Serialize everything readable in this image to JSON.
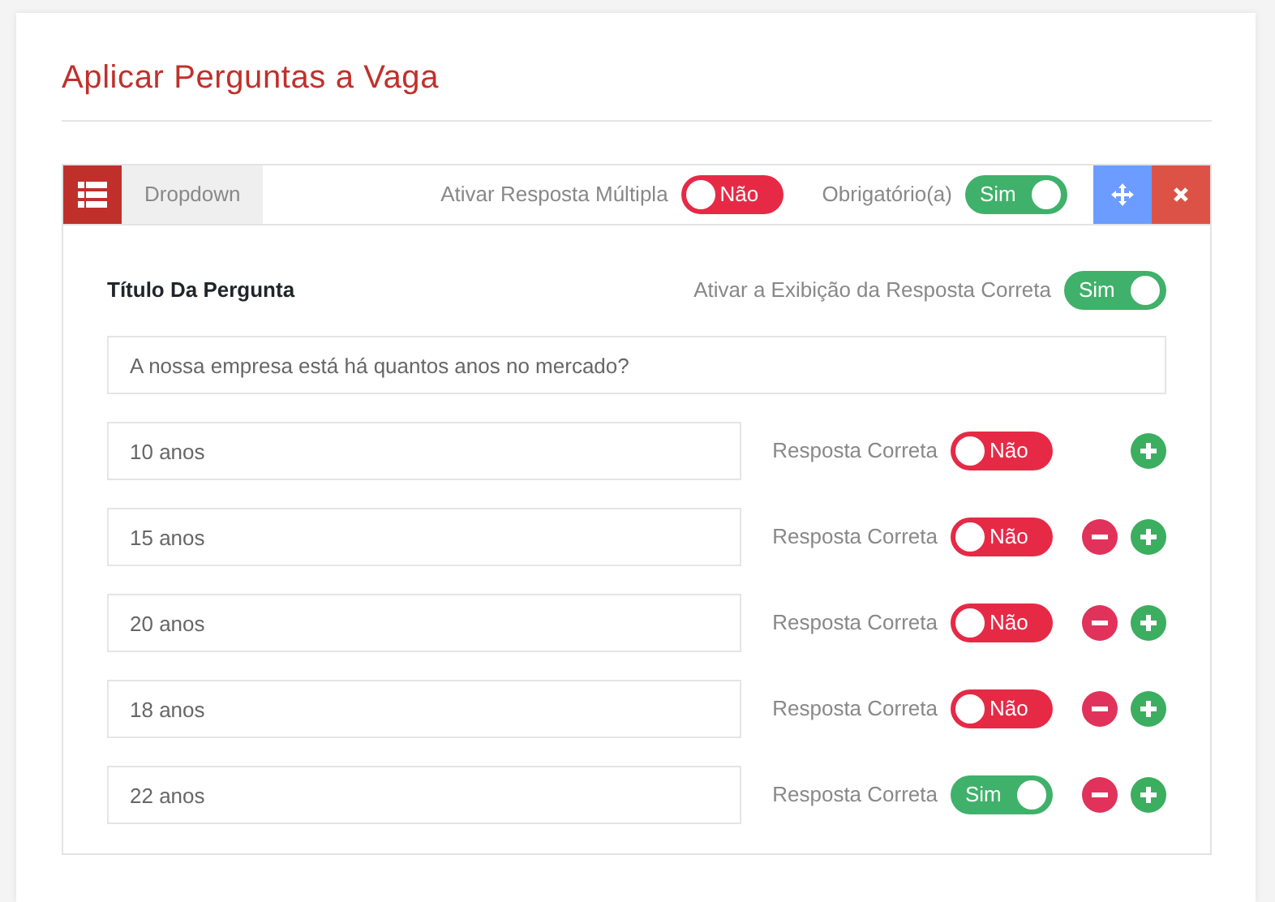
{
  "title": "Aplicar Perguntas a Vaga",
  "question": {
    "type_label": "Dropdown",
    "multiple": {
      "label": "Ativar Resposta Múltipla",
      "toggle": {
        "text": "Não",
        "on": false
      }
    },
    "required": {
      "label": "Obrigatório(a)",
      "toggle": {
        "text": "Sim",
        "on": true
      }
    },
    "title_label": "Título Da Pergunta",
    "show_correct": {
      "label": "Ativar a Exibição da Resposta Correta",
      "toggle": {
        "text": "Sim",
        "on": true
      }
    },
    "title_value": "A nossa empresa está há quantos anos no mercado?",
    "answers": [
      {
        "value": "10 anos",
        "correct_label": "Resposta Correta",
        "toggle": {
          "text": "Não",
          "on": false
        },
        "removable": false
      },
      {
        "value": "15 anos",
        "correct_label": "Resposta Correta",
        "toggle": {
          "text": "Não",
          "on": false
        },
        "removable": true
      },
      {
        "value": "20 anos",
        "correct_label": "Resposta Correta",
        "toggle": {
          "text": "Não",
          "on": false
        },
        "removable": true
      },
      {
        "value": "18 anos",
        "correct_label": "Resposta Correta",
        "toggle": {
          "text": "Não",
          "on": false
        },
        "removable": true
      },
      {
        "value": "22 anos",
        "correct_label": "Resposta Correta",
        "toggle": {
          "text": "Sim",
          "on": true
        },
        "removable": true
      }
    ]
  }
}
